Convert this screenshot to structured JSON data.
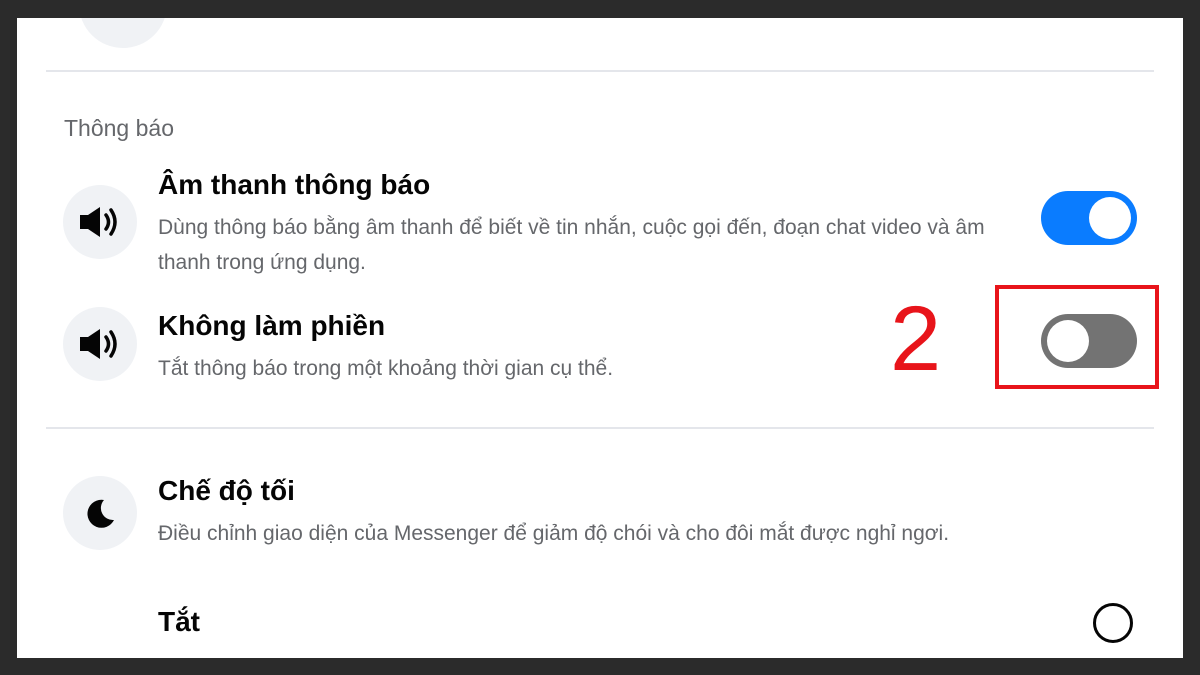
{
  "notifications": {
    "section_title": "Thông báo",
    "sound": {
      "title": "Âm thanh thông báo",
      "description": "Dùng thông báo bằng âm thanh để biết về tin nhắn, cuộc gọi đến, đoạn chat video và âm thanh trong ứng dụng.",
      "icon": "speaker-icon",
      "toggle_state": "on"
    },
    "dnd": {
      "title": "Không làm phiền",
      "description": "Tắt thông báo trong một khoảng thời gian cụ thể.",
      "icon": "speaker-icon",
      "toggle_state": "off"
    }
  },
  "annotation": {
    "step_number": "2",
    "color": "#e8141a"
  },
  "dark_mode": {
    "title": "Chế độ tối",
    "description": "Điều chỉnh giao diện của Messenger để giảm độ chói và cho đôi mắt được nghỉ ngơi.",
    "icon": "moon-icon",
    "options": [
      {
        "label": "Tắt",
        "selected": false
      }
    ]
  },
  "colors": {
    "toggle_on": "#0a7cff",
    "toggle_off": "#737373",
    "secondary_text": "#65676b"
  }
}
